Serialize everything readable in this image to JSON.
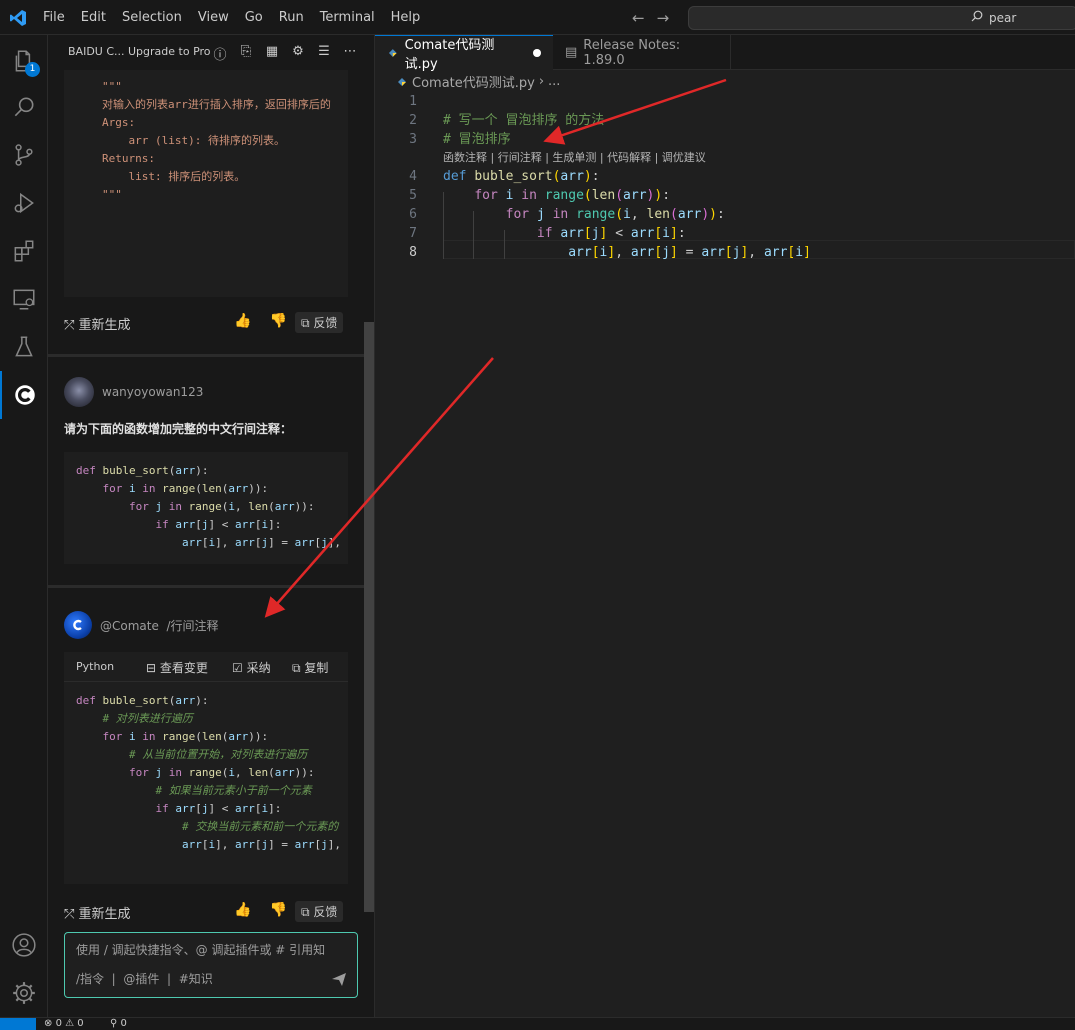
{
  "menu": [
    "File",
    "Edit",
    "Selection",
    "View",
    "Go",
    "Run",
    "Terminal",
    "Help"
  ],
  "search": {
    "value": "pear"
  },
  "activity": {
    "explorer_badge": "1"
  },
  "panel": {
    "title": "BAIDU C...",
    "upgrade": "Upgrade to Pro"
  },
  "chat": {
    "doc_block": [
      "\"\"\"",
      "对输入的列表arr进行插入排序，返回排序后的",
      "",
      "Args:",
      "    arr (list): 待排序的列表。",
      "",
      "Returns:",
      "    list: 排序后的列表。",
      "",
      "\"\"\""
    ],
    "regenerate": "重新生成",
    "feedback": "反馈",
    "user_name": "wanyoyowan123",
    "user_message": "请为下面的函数增加完整的中文行间注释：",
    "bot_name": "@Comate",
    "bot_command": "/行间注释",
    "code_lang": "Python",
    "view_changes": "查看变更",
    "accept": "采纳",
    "copy": "复制",
    "input_placeholder": "使用 / 调起快捷指令、@ 调起插件或 # 引用知",
    "chip_command": "/指令",
    "chip_plugin": "@插件",
    "chip_knowledge": "#知识"
  },
  "editor": {
    "tab_active": "Comate代码测试.py",
    "tab_release": "Release Notes: 1.89.0",
    "breadcrumb_file": "Comate代码测试.py",
    "breadcrumb_more": "...",
    "comment1": "# 写一个 冒泡排序 的方法",
    "comment2": "# 冒泡排序",
    "codelens": "函数注释 | 行间注释 | 生成单测 | 代码解释 | 调优建议",
    "line_numbers": [
      "1",
      "2",
      "3",
      "4",
      "5",
      "6",
      "7",
      "8"
    ]
  },
  "status": {
    "errors": "0",
    "warnings": "0",
    "ports": "0"
  },
  "colors": {
    "accent": "#0078d4",
    "annotation_arrow": "#e02828",
    "input_border": "#4ec9b0"
  }
}
